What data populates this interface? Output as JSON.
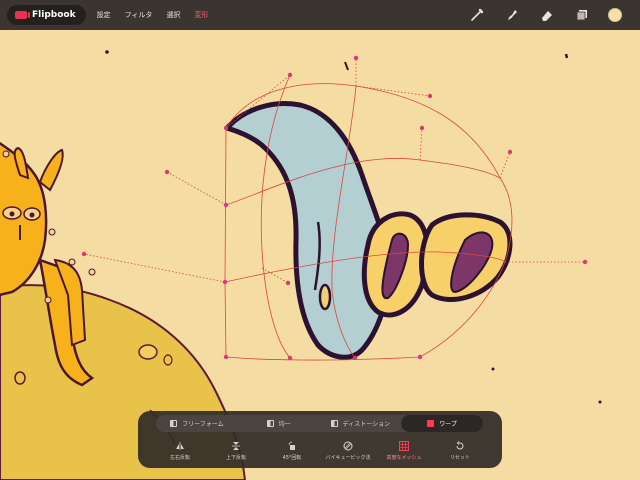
{
  "app": {
    "name": "Flipbook",
    "logo_color": "#e8334e"
  },
  "menu": {
    "items": [
      {
        "label": "設定",
        "active": false
      },
      {
        "label": "フィルタ",
        "active": false
      },
      {
        "label": "選択",
        "active": false
      },
      {
        "label": "変形",
        "active": true
      }
    ]
  },
  "tools": {
    "items": [
      "brush-icon",
      "smudge-icon",
      "eraser-icon",
      "layers-icon"
    ],
    "current_color": "#f7e0a8"
  },
  "transform": {
    "modes": [
      {
        "label": "フリーフォーム",
        "active": false
      },
      {
        "label": "均一",
        "active": false
      },
      {
        "label": "ディストーション",
        "active": false
      },
      {
        "label": "ワープ",
        "active": true
      }
    ],
    "actions": [
      {
        "label": "左右反転",
        "icon": "flip-horizontal-icon",
        "active": false
      },
      {
        "label": "上下反転",
        "icon": "flip-vertical-icon",
        "active": false
      },
      {
        "label": "45°回転",
        "icon": "rotate-45-icon",
        "active": false
      },
      {
        "label": "バイキュービック法",
        "icon": "bicubic-icon",
        "active": false
      },
      {
        "label": "高度なメッシュ",
        "icon": "mesh-icon",
        "active": true
      },
      {
        "label": "リセット",
        "icon": "reset-icon",
        "active": false
      }
    ]
  },
  "colors": {
    "canvas_bg": "#f4dca2",
    "accent": "#ff3b55",
    "warp_line": "#d9473e"
  }
}
